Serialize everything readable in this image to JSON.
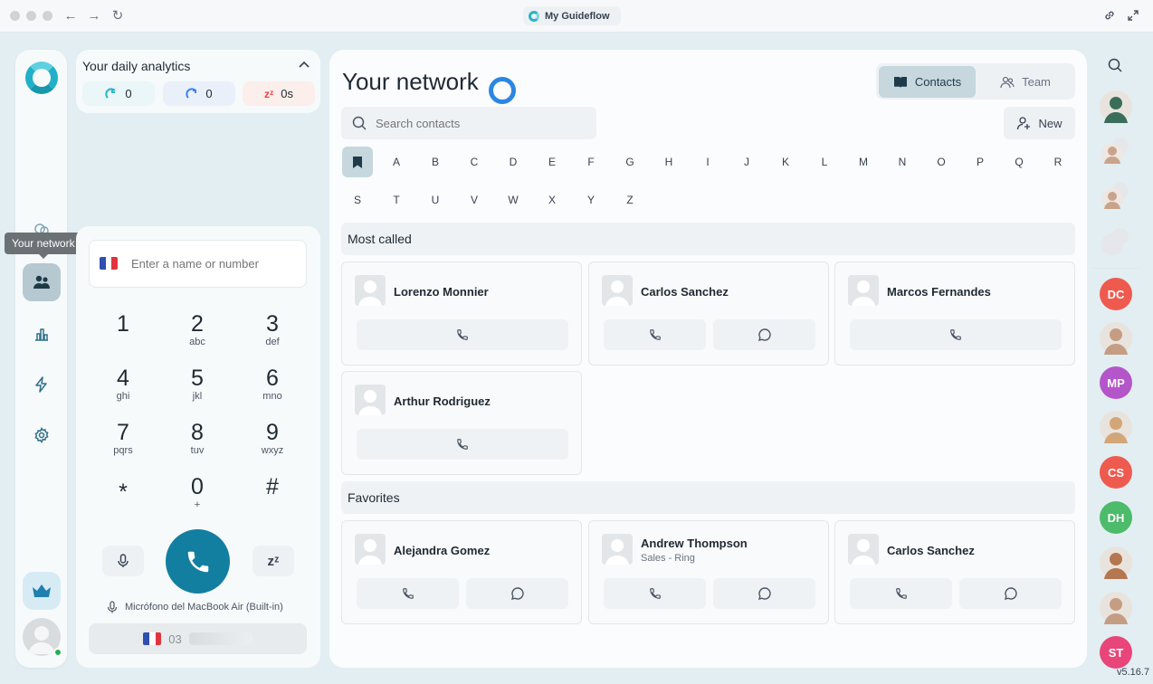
{
  "window": {
    "title": "My Guideflow"
  },
  "rail": {
    "tooltip": "Your network"
  },
  "analytics": {
    "title": "Your daily analytics",
    "stats": [
      {
        "icon": "incoming-call-icon",
        "value": "0",
        "color": "#2bb3c9"
      },
      {
        "icon": "outgoing-call-icon",
        "value": "0",
        "color": "#3b82f6"
      },
      {
        "icon": "snooze-icon",
        "value": "0s",
        "color": "#ef4444"
      }
    ]
  },
  "dialer": {
    "placeholder": "Enter a name or number",
    "keys": [
      {
        "d": "1",
        "l": ""
      },
      {
        "d": "2",
        "l": "abc"
      },
      {
        "d": "3",
        "l": "def"
      },
      {
        "d": "4",
        "l": "ghi"
      },
      {
        "d": "5",
        "l": "jkl"
      },
      {
        "d": "6",
        "l": "mno"
      },
      {
        "d": "7",
        "l": "pqrs"
      },
      {
        "d": "8",
        "l": "tuv"
      },
      {
        "d": "9",
        "l": "wxyz"
      },
      {
        "d": "*",
        "l": ""
      },
      {
        "d": "0",
        "l": "+"
      },
      {
        "d": "#",
        "l": ""
      }
    ],
    "mic_label": "Micrófono del MacBook Air (Built-in)",
    "caller_id_prefix": "03",
    "snooze_label": "zᶻ"
  },
  "main": {
    "title": "Your network",
    "search_placeholder": "Search contacts",
    "tabs": {
      "contacts": "Contacts",
      "team": "Team"
    },
    "new_label": "New",
    "letters_row1": [
      "A",
      "B",
      "C",
      "D",
      "E",
      "F",
      "G",
      "H",
      "I",
      "J",
      "K",
      "L",
      "M",
      "N",
      "O",
      "P",
      "Q",
      "R"
    ],
    "letters_row2": [
      "S",
      "T",
      "U",
      "V",
      "W",
      "X",
      "Y",
      "Z"
    ],
    "most_called_title": "Most called",
    "favorites_title": "Favorites",
    "most_called": [
      {
        "name": "Lorenzo Monnier",
        "sub": "",
        "message": false
      },
      {
        "name": "Carlos Sanchez",
        "sub": "",
        "message": true
      },
      {
        "name": "Marcos Fernandes",
        "sub": "",
        "message": false
      },
      {
        "name": "Arthur Rodriguez",
        "sub": "",
        "message": false
      }
    ],
    "favorites": [
      {
        "name": "Alejandra Gomez",
        "sub": "",
        "message": true
      },
      {
        "name": "Andrew Thompson",
        "sub": "Sales - Ring",
        "message": true
      },
      {
        "name": "Carlos Sanchez",
        "sub": "",
        "message": true
      }
    ]
  },
  "team_rail": {
    "people": [
      {
        "type": "photo",
        "label": "",
        "color": "#3b6e5a"
      },
      {
        "type": "group",
        "label": "",
        "color": "#c9a48c"
      },
      {
        "type": "group",
        "label": "",
        "color": "#c9a48c"
      },
      {
        "type": "group-empty",
        "label": "",
        "color": "#e5e7eb"
      },
      {
        "type": "initials",
        "label": "DC",
        "color": "#ef5a4f"
      },
      {
        "type": "photo",
        "label": "",
        "color": "#c59d83"
      },
      {
        "type": "initials",
        "label": "MP",
        "color": "#b455c9"
      },
      {
        "type": "photo",
        "label": "",
        "color": "#d2a677"
      },
      {
        "type": "initials",
        "label": "CS",
        "color": "#ef5a4f"
      },
      {
        "type": "initials",
        "label": "DH",
        "color": "#4cbb6a"
      },
      {
        "type": "photo",
        "label": "",
        "color": "#b5774f"
      },
      {
        "type": "photo",
        "label": "",
        "color": "#c59d83"
      },
      {
        "type": "initials",
        "label": "ST",
        "color": "#e8457a"
      }
    ],
    "version": "v5.16.7"
  }
}
